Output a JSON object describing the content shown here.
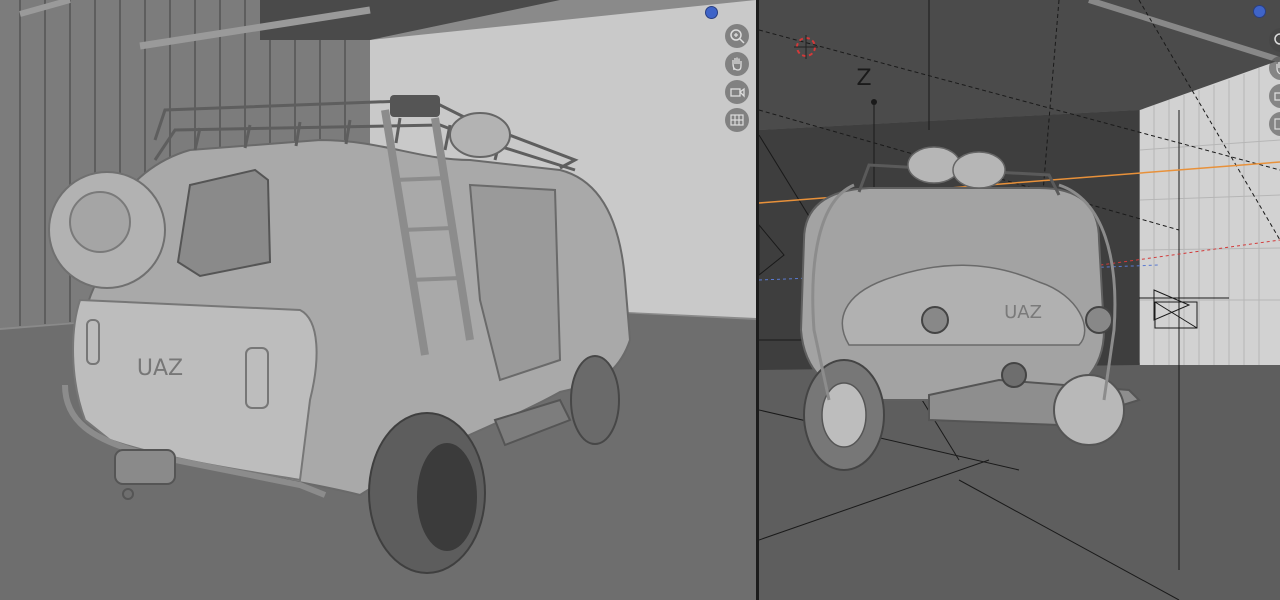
{
  "viewports": {
    "left": {
      "view": "solid-shading",
      "vehicle_badge": "UAZ",
      "nav_icons": [
        "zoom-icon",
        "hand-pan-icon",
        "camera-view-icon",
        "grid-ortho-icon"
      ]
    },
    "right": {
      "view": "solid-shading-with-overlays",
      "vehicle_badge": "UAZ",
      "axis_label": "Z",
      "nav_icons": [
        "zoom-icon",
        "hand-pan-icon",
        "camera-view-icon",
        "grid-ortho-icon"
      ]
    }
  },
  "colors": {
    "axis_dot": "#3f64c8",
    "selection_orange": "#e8913a",
    "cursor_red": "#d23a3a"
  }
}
